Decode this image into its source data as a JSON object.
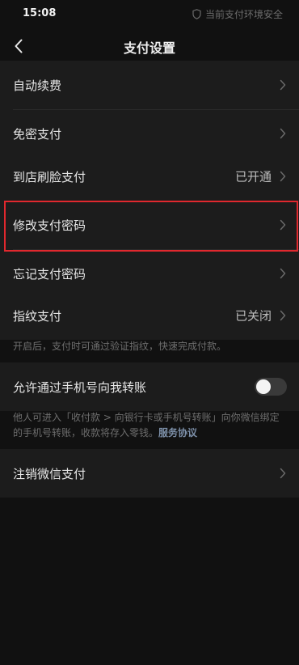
{
  "status_bar": {
    "time": "15:08",
    "security_text": "当前支付环境安全"
  },
  "header": {
    "title": "支付设置"
  },
  "groups": {
    "g1": [
      {
        "label": "自动续费"
      },
      {
        "label": "免密支付"
      }
    ],
    "g2": [
      {
        "label": "到店刷脸支付",
        "value": "已开通"
      },
      {
        "label": "修改支付密码"
      },
      {
        "label": "忘记支付密码"
      }
    ],
    "g3": [
      {
        "label": "指纹支付",
        "value": "已关闭"
      }
    ],
    "g4": [
      {
        "label": "允许通过手机号向我转账",
        "toggle_on": false
      }
    ],
    "g5": [
      {
        "label": "注销微信支付"
      }
    ]
  },
  "notes": {
    "fingerprint": "开启后，支付时可通过验证指纹，快速完成付款。",
    "phone_transfer": "他人可进入「收付款 > 向银行卡或手机号转账」向你微信绑定的手机号转账，收款将存入零钱。",
    "service_agreement": "服务协议"
  },
  "colors": {
    "background": "#111111",
    "row_background": "#1c1c1c",
    "highlight_box": "#e0282e",
    "link": "#7d90a9"
  },
  "icons": {
    "back": "chevron-left-icon",
    "row_arrow": "chevron-right-icon",
    "security": "shield-icon"
  }
}
